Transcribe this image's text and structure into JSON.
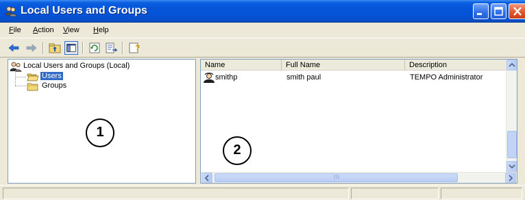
{
  "window": {
    "title": "Local Users and Groups"
  },
  "menu": {
    "items": [
      {
        "label": "File",
        "underline": "F",
        "rest": "ile"
      },
      {
        "label": "Action",
        "underline": "A",
        "rest": "ction"
      },
      {
        "label": "View",
        "underline": "V",
        "rest": "iew"
      },
      {
        "label": "Help",
        "underline": "H",
        "rest": "elp"
      }
    ]
  },
  "toolbar": {
    "icons": [
      "back-arrow-icon",
      "forward-arrow-icon",
      "up-folder-icon",
      "show-hide-tree-icon",
      "refresh-icon",
      "export-list-icon",
      "help-icon"
    ]
  },
  "tree": {
    "root_label": "Local Users and Groups (Local)",
    "nodes": [
      {
        "label": "Users",
        "selected": true
      },
      {
        "label": "Groups",
        "selected": false
      }
    ]
  },
  "list": {
    "columns": [
      "Name",
      "Full Name",
      "Description"
    ],
    "rows": [
      {
        "name": "smithp",
        "full_name": "smith paul",
        "description": "TEMPO Administrator"
      }
    ]
  },
  "callouts": {
    "left": "1",
    "right": "2"
  },
  "colors": {
    "titlebar": "#0553d6",
    "selection": "#316ac5",
    "window_bg": "#ece9d8"
  }
}
